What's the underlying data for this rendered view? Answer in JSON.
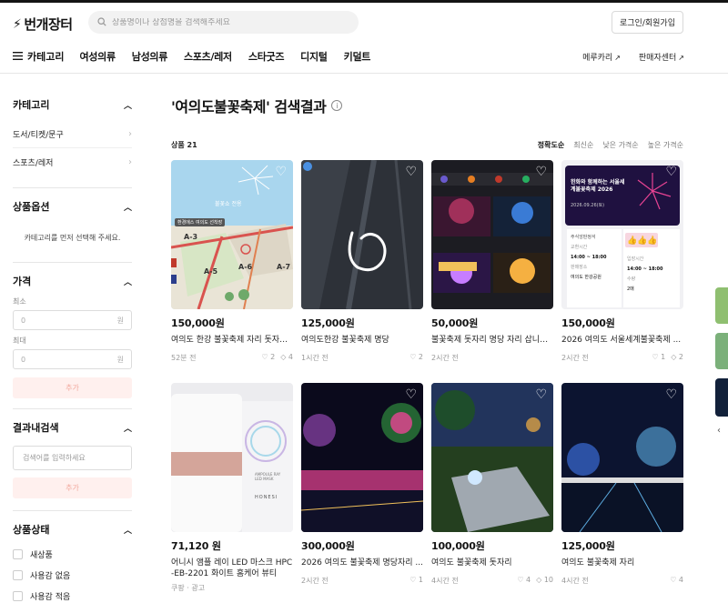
{
  "header": {
    "logo": "번개장터",
    "search_placeholder": "상품명이나 상점명을 검색해주세요",
    "login_label": "로그인/회원가입"
  },
  "nav": {
    "category_label": "카테고리",
    "items": [
      "여성의류",
      "남성의류",
      "스포츠/레저",
      "스타굿즈",
      "디지털",
      "키덜트"
    ],
    "right": [
      "메루카리",
      "판매자센터"
    ]
  },
  "sidebar": {
    "category": {
      "title": "카테고리",
      "links": [
        "도서/티켓/문구",
        "스포츠/레저"
      ]
    },
    "options": {
      "title": "상품옵션",
      "hint": "카테고리를 먼저 선택해 주세요."
    },
    "price": {
      "title": "가격",
      "min_label": "최소",
      "max_label": "최대",
      "min_value": "0",
      "max_value": "0",
      "unit": "원",
      "add_label": "추가"
    },
    "in_results": {
      "title": "결과내검색",
      "placeholder": "검색어를 입력하세요",
      "add_label": "추가"
    },
    "condition": {
      "title": "상품상태",
      "items": [
        "새상품",
        "사용감 없음",
        "사용감 적음"
      ]
    }
  },
  "main": {
    "title": "'여의도불꽃축제' 검색결과",
    "count_label": "상품 21",
    "sorts": [
      "정확도순",
      "최신순",
      "낮은 가격순",
      "높은 가격순"
    ],
    "active_sort": "정확도순",
    "products": [
      {
        "price": "150,000원",
        "title": "여의도 한강 불꽃축제 자리 돗자리...",
        "time": "52분 전",
        "stats": [
          "♡ 2",
          "◇ 4"
        ]
      },
      {
        "price": "125,000원",
        "title": "여의도한강 불꽃축제 명당",
        "time": "1시간 전",
        "stats": [
          "♡ 2"
        ]
      },
      {
        "price": "50,000원",
        "title": "불꽃축제 돗자리 명당 자리 삽니다...",
        "time": "2시간 전",
        "stats": []
      },
      {
        "price": "150,000원",
        "title": "2026 여의도 서울세계불꽃축제 ...",
        "time": "2시간 전",
        "stats": [
          "♡ 1",
          "◇ 2"
        ]
      },
      {
        "price": "71,120 원",
        "title": "어니시 앰플 레이 LED 마스크 HPC -EB-2201 화이트 홈케어 뷰티 디...",
        "time": "쿠팡 · 광고",
        "stats": []
      },
      {
        "price": "300,000원",
        "title": "2026 여의도 불꽃축제 명당자리 ...",
        "time": "2시간 전",
        "stats": [
          "♡ 1"
        ]
      },
      {
        "price": "100,000원",
        "title": "여의도 불꽃축제 돗자리",
        "time": "4시간 전",
        "stats": [
          "♡ 4",
          "◇ 10"
        ]
      },
      {
        "price": "125,000원",
        "title": "여의도 불꽃축제 자리",
        "time": "4시간 전",
        "stats": [
          "♡ 4"
        ]
      }
    ]
  },
  "thumb_texts": {
    "p1_sign": "불꽃쇼 전용",
    "p1_stop": "환경에스 여의도 선착장",
    "p1_zones": [
      "A-3",
      "A-5",
      "A-6",
      "A-7"
    ],
    "p4_title": "한화와 함께하는 서울세계불꽃축제 2026",
    "p4_date": "2026.09.26(토)",
    "p4_rows": [
      "주식앙판정석",
      "교환시간",
      "14:00 ~ 18:00",
      "입장시간",
      "14:00 ~ 18:00",
      "판매장소",
      "여의도 한강공원",
      "수량",
      "2매"
    ],
    "p5_brand": "HONESI",
    "p5_model": "AMPOULE RAY LED MASK"
  },
  "colors": {
    "brand": "#141414",
    "accent_light": "#fff0ee",
    "accent_text": "#f2a79c"
  }
}
